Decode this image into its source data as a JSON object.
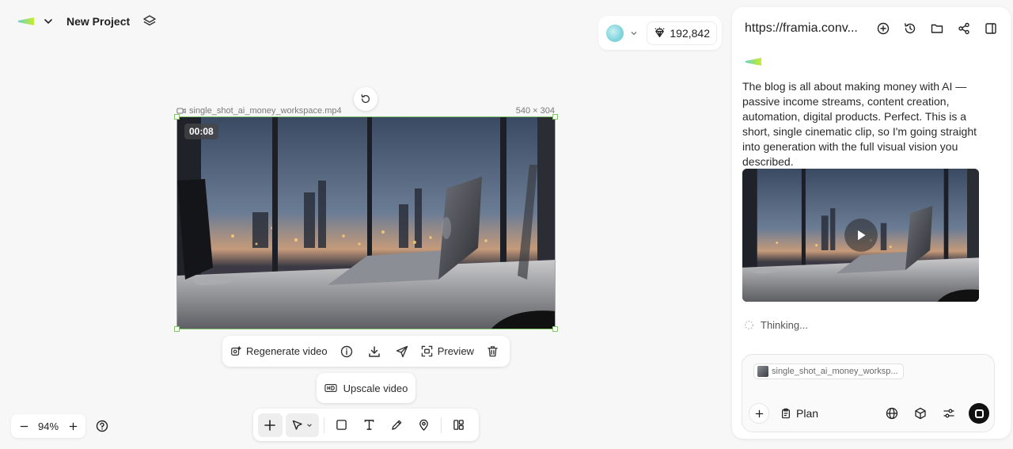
{
  "project": {
    "title": "New Project"
  },
  "credits": {
    "value": "192,842"
  },
  "canvas": {
    "file_name": "single_shot_ai_money_workspace.mp4",
    "dimensions": "540 × 304",
    "timestamp": "00:08"
  },
  "actions": {
    "regenerate": "Regenerate video",
    "preview": "Preview",
    "upscale": "Upscale video"
  },
  "zoom": {
    "level": "94%"
  },
  "panel": {
    "url": "https://framia.conv...",
    "message": "The blog is all about making money with AI — passive income streams, content creation, automation, digital products. Perfect. This is a short, single cinematic clip, so I'm going straight into generation with the full visual vision you described.",
    "status": "Thinking...",
    "attachment": "single_shot_ai_money_worksp...",
    "plan_label": "Plan"
  },
  "colors": {
    "selection": "#86c56b",
    "brand_green": "#b5e636",
    "brand_teal": "#6cc6d1"
  }
}
